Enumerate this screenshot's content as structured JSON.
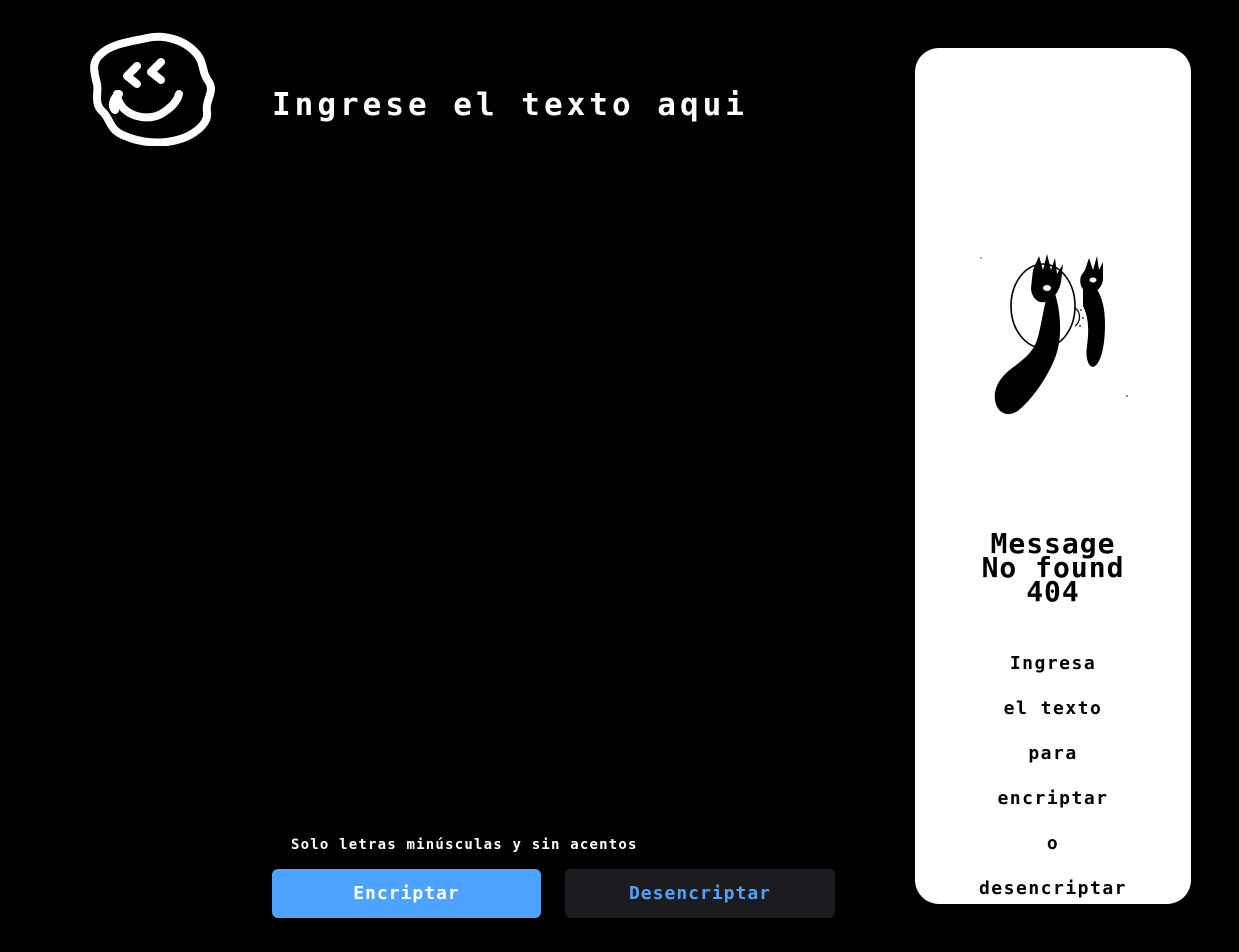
{
  "input": {
    "placeholder": "Ingrese el texto aqui",
    "value": ""
  },
  "hint": {
    "icon": "info-icon",
    "text": "Solo letras minúsculas y sin acentos"
  },
  "buttons": {
    "encrypt_label": "Encriptar",
    "decrypt_label": "Desencriptar"
  },
  "output": {
    "title_lines": [
      "Message",
      "No found",
      "404"
    ],
    "message_lines": [
      "Ingresa",
      "el texto",
      "para",
      "encriptar",
      "o",
      "desencriptar"
    ]
  },
  "logo": {
    "icon": "smiley-logo-icon"
  },
  "colors": {
    "background": "#000000",
    "accent": "#4da3ff",
    "panel": "#ffffff",
    "secondary_button": "#1c1c20"
  }
}
